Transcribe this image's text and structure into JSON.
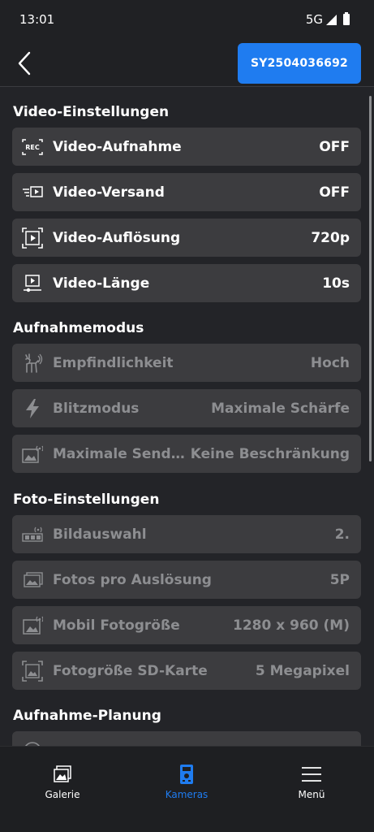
{
  "status": {
    "time": "13:01",
    "network": "5G"
  },
  "header": {
    "device_id": "SY2504036692"
  },
  "sections": {
    "video": {
      "title": "Video-Einstellungen",
      "items": [
        {
          "label": "Video-Aufnahme",
          "value": "OFF",
          "icon": "rec-icon"
        },
        {
          "label": "Video-Versand",
          "value": "OFF",
          "icon": "video-send-icon"
        },
        {
          "label": "Video-Auflösung",
          "value": "720p",
          "icon": "video-resolution-icon"
        },
        {
          "label": "Video-Länge",
          "value": "10s",
          "icon": "video-length-icon"
        }
      ]
    },
    "mode": {
      "title": "Aufnahmemodus",
      "items": [
        {
          "label": "Empfindlichkeit",
          "value": "Hoch",
          "icon": "deer-sensitivity-icon"
        },
        {
          "label": "Blitzmodus",
          "value": "Maximale Schärfe",
          "icon": "flash-icon"
        },
        {
          "label": "Maximale Sendungen pro Tag",
          "value": "Keine Beschränkung",
          "icon": "max-send-icon"
        }
      ]
    },
    "photo": {
      "title": "Foto-Einstellungen",
      "items": [
        {
          "label": "Bildauswahl",
          "value": "2.",
          "icon": "image-select-icon"
        },
        {
          "label": "Fotos pro Auslösung",
          "value": "5P",
          "icon": "photos-per-trigger-icon"
        },
        {
          "label": "Mobil Fotogröße",
          "value": "1280 x 960 (M)",
          "icon": "mobile-photo-size-icon"
        },
        {
          "label": "Fotogröße SD-Karte",
          "value": "5 Megapixel",
          "icon": "sd-photo-size-icon"
        }
      ]
    },
    "schedule": {
      "title": "Aufnahme-Planung"
    }
  },
  "nav": {
    "gallery": "Galerie",
    "cameras": "Kameras",
    "menu": "Menü"
  },
  "colors": {
    "accent": "#1f7cf0",
    "row_bg": "#3c3c3f",
    "disabled_text": "#8d8e91",
    "background": "#232428"
  }
}
